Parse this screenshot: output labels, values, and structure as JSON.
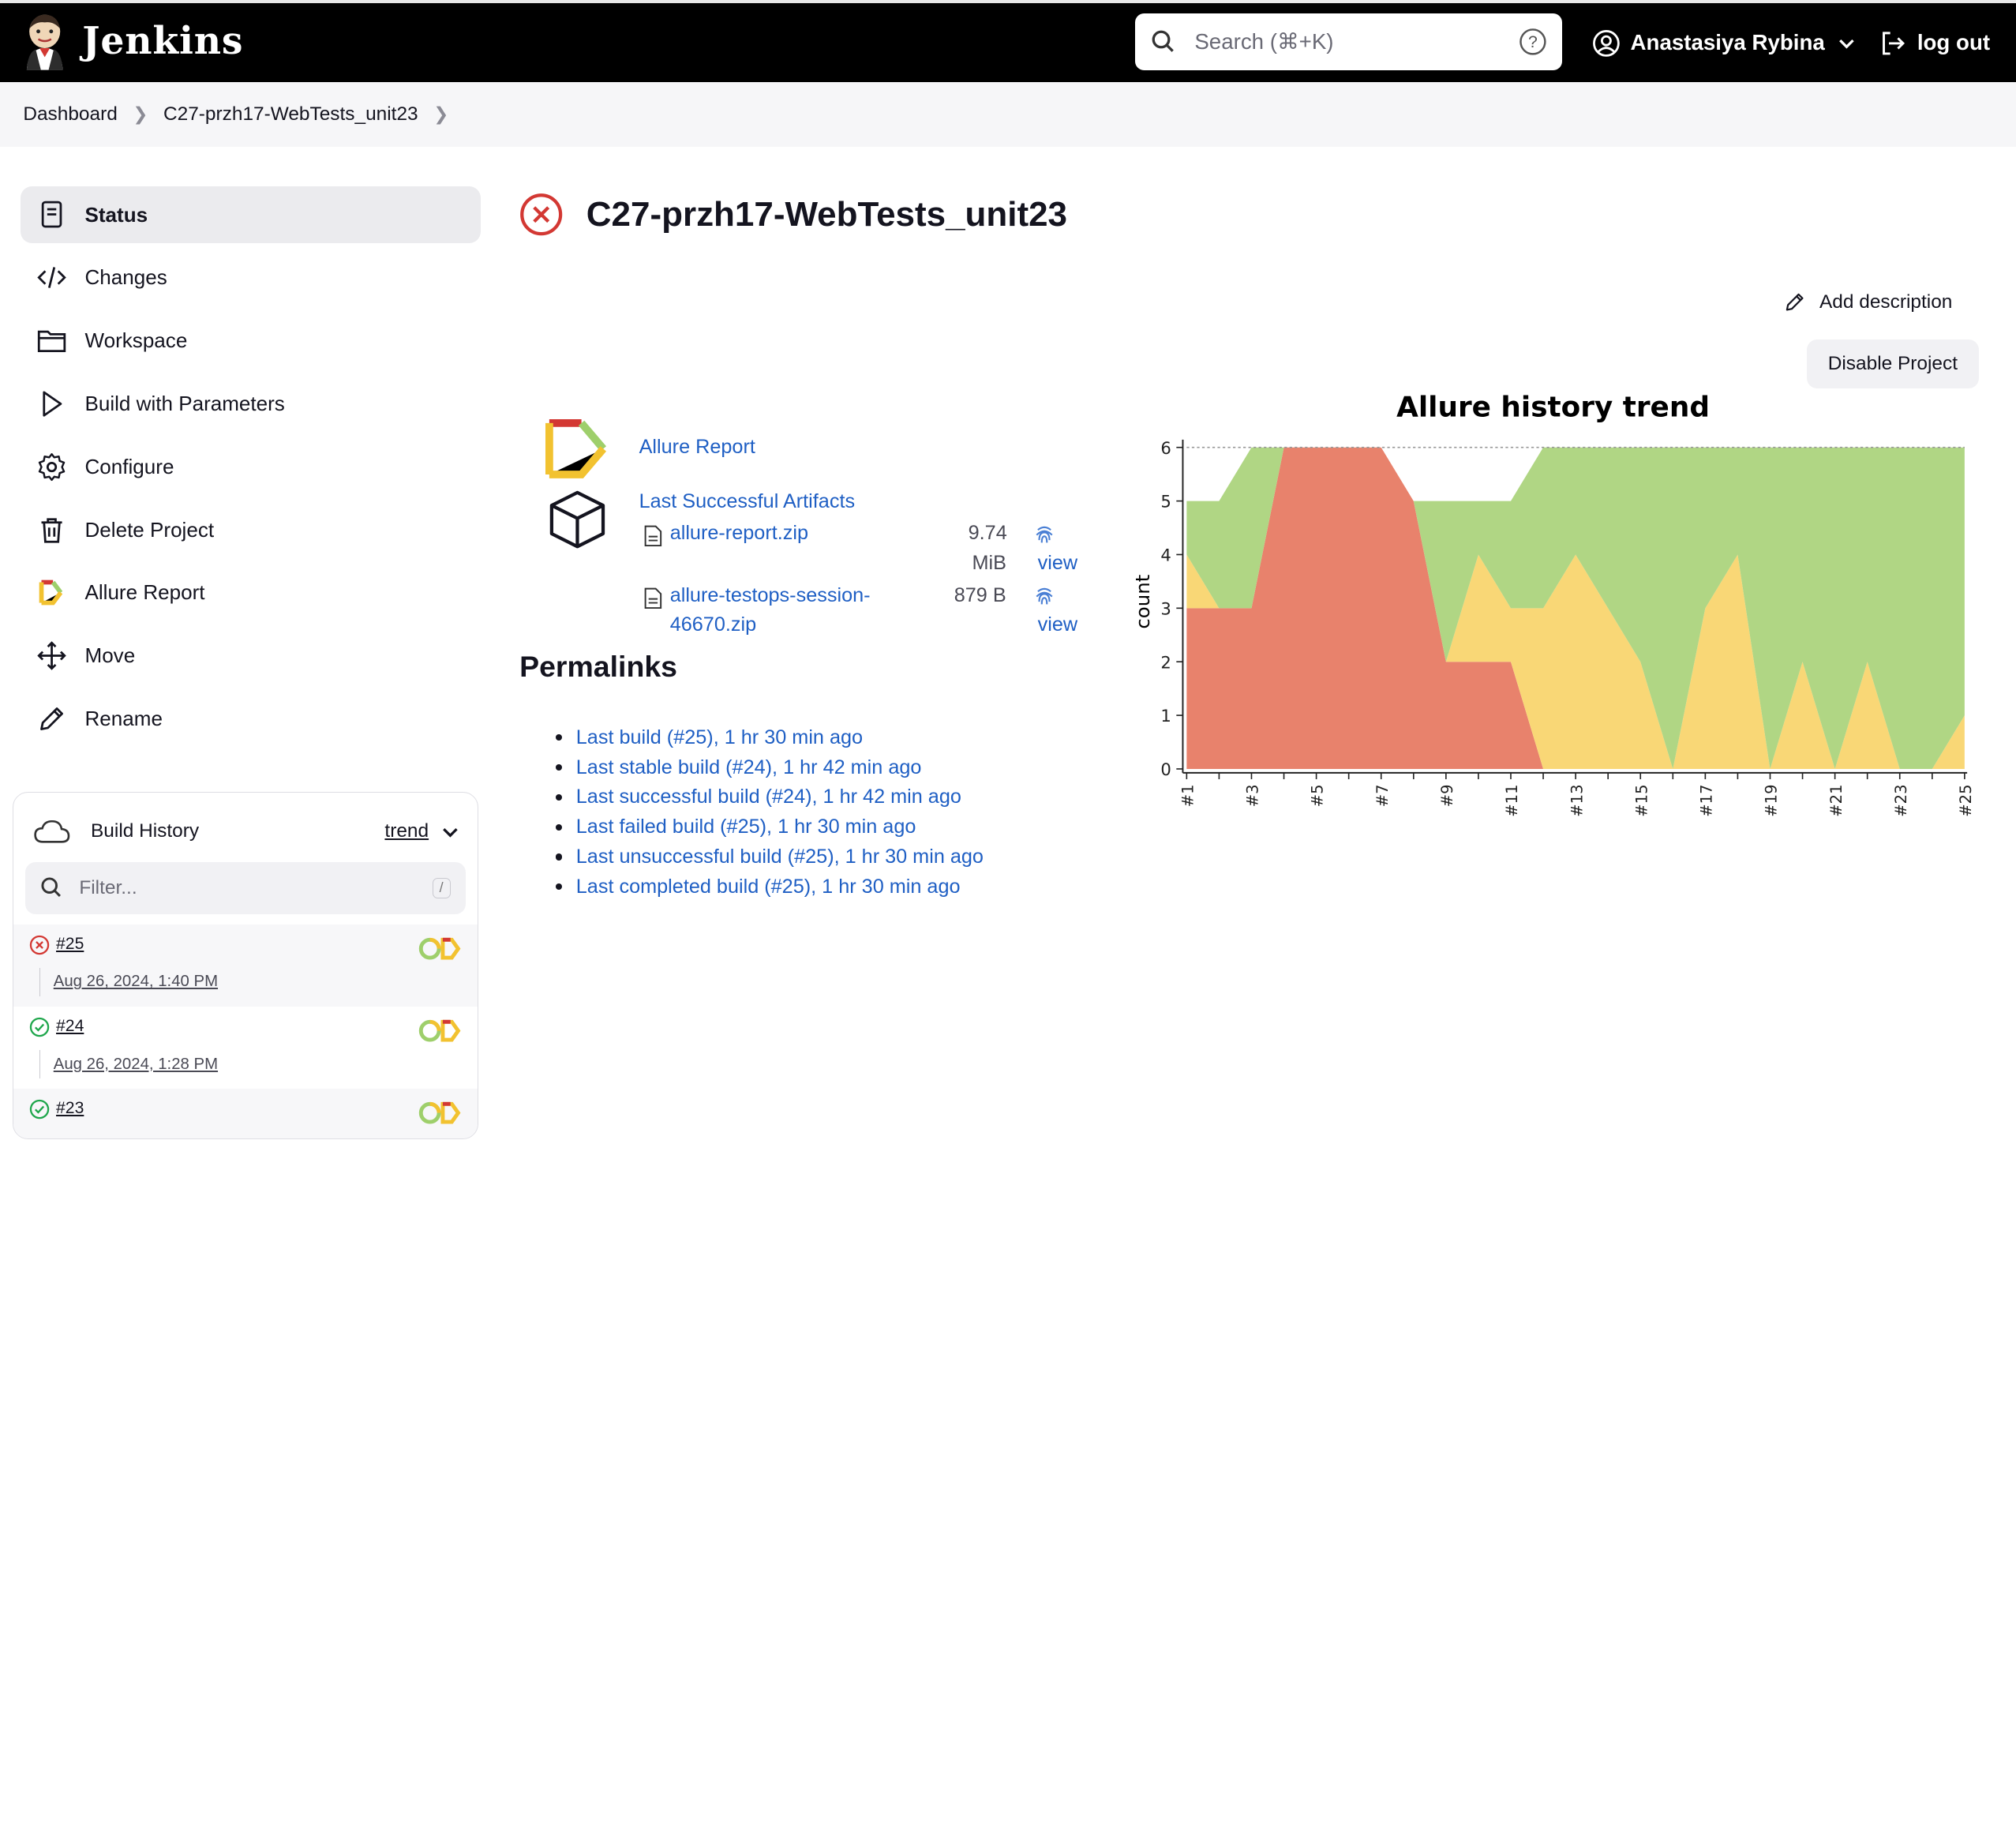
{
  "header": {
    "app_title": "Jenkins",
    "search_placeholder": "Search (⌘+K)",
    "user_name": "Anastasiya Rybina",
    "logout_label": "log out"
  },
  "breadcrumb": [
    "Dashboard",
    "C27-przh17-WebTests_unit23"
  ],
  "sidebar": {
    "items": [
      {
        "label": "Status",
        "icon": "status-icon"
      },
      {
        "label": "Changes",
        "icon": "code-icon"
      },
      {
        "label": "Workspace",
        "icon": "folder-icon"
      },
      {
        "label": "Build with Parameters",
        "icon": "play-icon"
      },
      {
        "label": "Configure",
        "icon": "gear-icon"
      },
      {
        "label": "Delete Project",
        "icon": "trash-icon"
      },
      {
        "label": "Allure Report",
        "icon": "allure-icon"
      },
      {
        "label": "Move",
        "icon": "move-icon"
      },
      {
        "label": "Rename",
        "icon": "pencil-icon"
      }
    ]
  },
  "build_history": {
    "title": "Build History",
    "trend_label": "trend",
    "filter_placeholder": "Filter...",
    "filter_shortcut": "/",
    "builds": [
      {
        "number": "#25",
        "date": "Aug 26, 2024, 1:40 PM",
        "status": "failed"
      },
      {
        "number": "#24",
        "date": "Aug 26, 2024, 1:28 PM",
        "status": "success"
      },
      {
        "number": "#23",
        "date": "",
        "status": "success"
      }
    ]
  },
  "main": {
    "project_title": "C27-przh17-WebTests_unit23",
    "add_description": "Add description",
    "disable_project": "Disable Project",
    "allure_report_link": "Allure Report",
    "last_successful_artifacts": "Last Successful Artifacts",
    "artifacts": [
      {
        "name_line1": "allure-report.zip",
        "name_line2": "",
        "size_line1": "9.74",
        "size_line2": "MiB",
        "view": "view"
      },
      {
        "name_line1": "allure-testops-session-",
        "name_line2": "46670.zip",
        "size_line1": "879 B",
        "size_line2": "",
        "view": "view"
      }
    ],
    "permalinks_title": "Permalinks",
    "permalinks": [
      "Last build (#25), 1 hr 30 min ago",
      "Last stable build (#24), 1 hr 42 min ago",
      "Last successful build (#24), 1 hr 42 min ago",
      "Last failed build (#25), 1 hr 30 min ago",
      "Last unsuccessful build (#25), 1 hr 30 min ago",
      "Last completed build (#25), 1 hr 30 min ago"
    ]
  },
  "colors": {
    "failed": "#e8826c",
    "broken": "#f9d776",
    "passed": "#b0d684",
    "link": "#1f5fc4",
    "error_red": "#d33833",
    "success_green": "#1ea64b"
  },
  "chart_data": {
    "type": "area",
    "title": "Allure history trend",
    "ylabel": "count",
    "xlabel": "",
    "ylim": [
      0,
      6
    ],
    "yticks": [
      0,
      1,
      2,
      3,
      4,
      5,
      6
    ],
    "x": [
      "#1",
      "#2",
      "#3",
      "#4",
      "#5",
      "#6",
      "#7",
      "#8",
      "#9",
      "#10",
      "#11",
      "#12",
      "#13",
      "#14",
      "#15",
      "#16",
      "#17",
      "#18",
      "#19",
      "#20",
      "#21",
      "#22",
      "#23",
      "#24",
      "#25"
    ],
    "x_tick_labels": [
      "#1",
      "#3",
      "#5",
      "#7",
      "#9",
      "#11",
      "#13",
      "#15",
      "#17",
      "#19",
      "#21",
      "#23",
      "#25"
    ],
    "stacked": true,
    "series": [
      {
        "name": "failed",
        "values": [
          3,
          3,
          3,
          6,
          6,
          6,
          6,
          5,
          2,
          2,
          2,
          0,
          0,
          0,
          0,
          0,
          0,
          0,
          0,
          0,
          0,
          0,
          0,
          0,
          0
        ]
      },
      {
        "name": "broken",
        "values": [
          1,
          0,
          0,
          0,
          0,
          0,
          0,
          0,
          0,
          2,
          1,
          3,
          4,
          3,
          2,
          0,
          3,
          4,
          0,
          2,
          0,
          2,
          0,
          0,
          1
        ]
      },
      {
        "name": "passed",
        "values": [
          1,
          2,
          3,
          0,
          0,
          0,
          0,
          0,
          3,
          1,
          2,
          3,
          2,
          3,
          4,
          6,
          3,
          2,
          6,
          4,
          6,
          4,
          6,
          6,
          5
        ]
      }
    ]
  }
}
